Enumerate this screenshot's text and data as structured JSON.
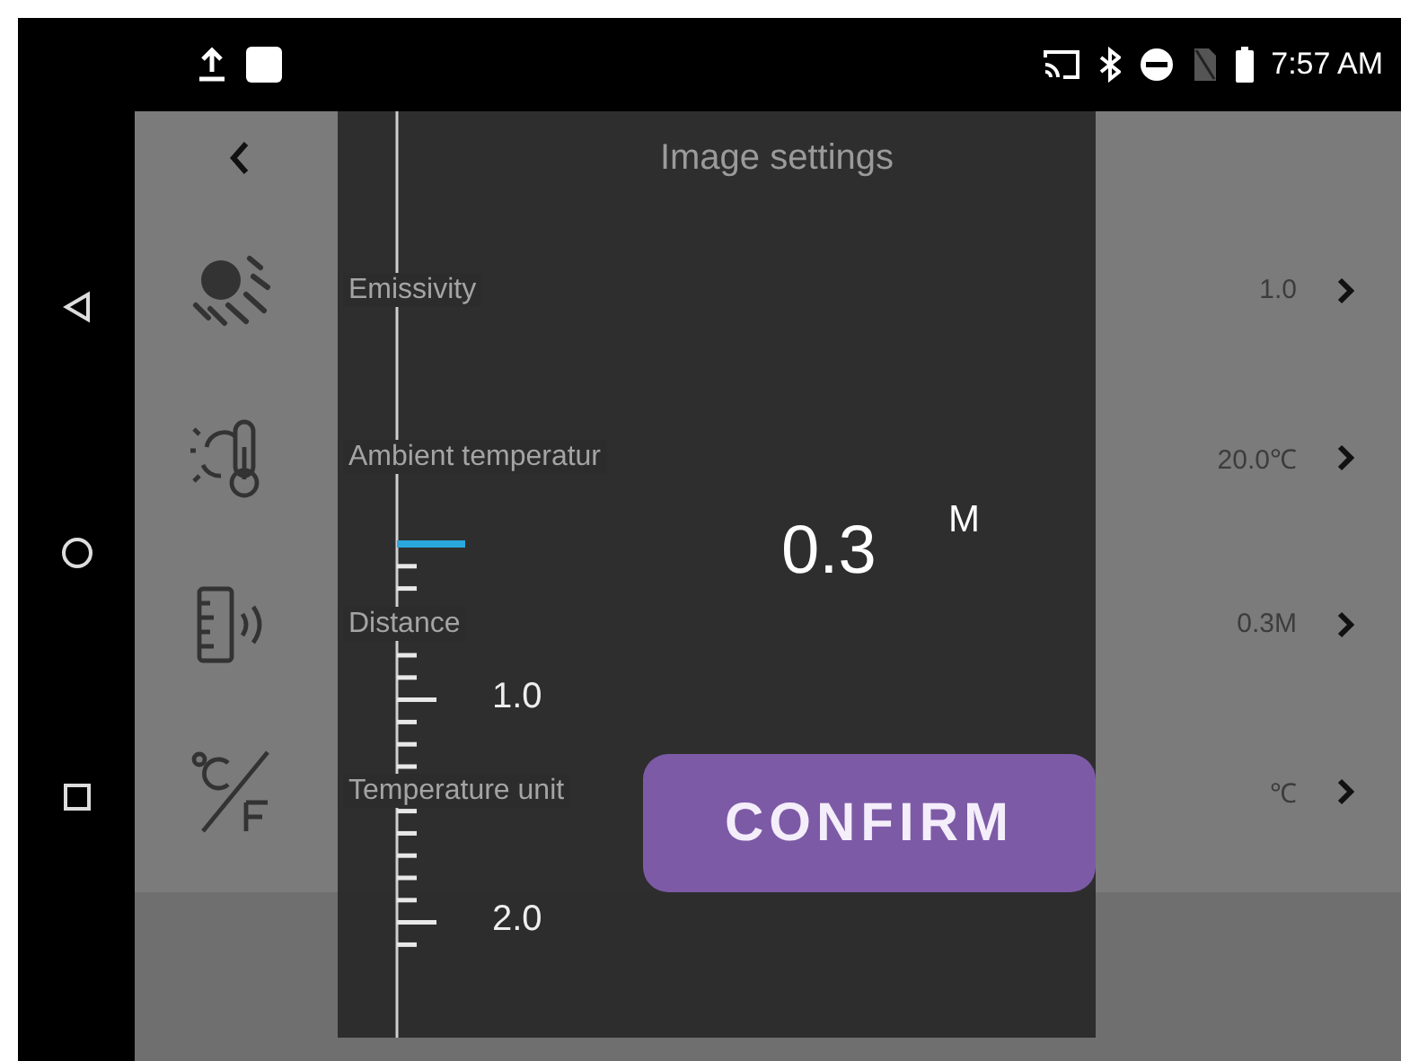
{
  "status_bar": {
    "time": "7:57 AM"
  },
  "header": {
    "title": "Image settings"
  },
  "settings": [
    {
      "kind": "emissivity",
      "label": "Emissivity",
      "value": "1.0"
    },
    {
      "kind": "ambient",
      "label": "Ambient temperatur",
      "value": "20.0℃"
    },
    {
      "kind": "distance",
      "label": "Distance",
      "value": "0.3M"
    },
    {
      "kind": "unit",
      "label": "Temperature unit",
      "value": "℃"
    }
  ],
  "picker": {
    "value": "0.3",
    "unit": "M",
    "scale_labels": [
      "1.0",
      "2.0"
    ],
    "confirm": "CONFIRM"
  }
}
